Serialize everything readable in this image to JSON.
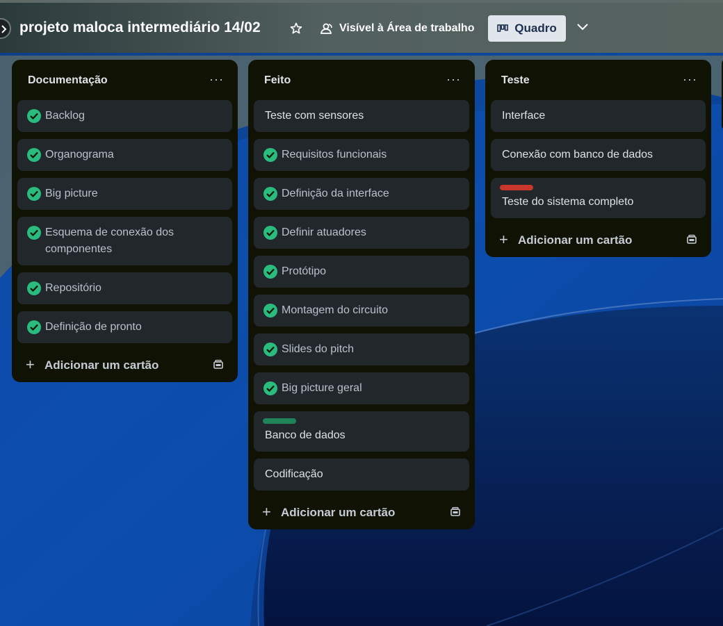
{
  "header": {
    "title": "projeto maloca intermediário 14/02",
    "visibility": "Visível à Área de trabalho",
    "view": "Quadro"
  },
  "icons": {
    "star": "star-icon",
    "visibility": "workspace-visibility-icon",
    "view": "board-view-icon",
    "dropdown": "chevron-down-icon",
    "card_done": "check-circle-icon",
    "add": "plus-icon",
    "template": "card-template-icon"
  },
  "colors": {
    "check": "#2abb7f",
    "label_green": "#1f845a",
    "label_red": "#c9372c",
    "list_bg": "#101204",
    "card_bg": "#22272b"
  },
  "lists": [
    {
      "title": "Documentação",
      "menu": "···",
      "add_label": "Adicionar um cartão",
      "cards": [
        {
          "text": "Backlog",
          "done": true
        },
        {
          "text": "Organograma",
          "done": true
        },
        {
          "text": "Big picture",
          "done": true
        },
        {
          "text": "Esquema de conexão dos componentes",
          "done": true
        },
        {
          "text": "Repositório",
          "done": true
        },
        {
          "text": "Definição de pronto",
          "done": true
        }
      ]
    },
    {
      "title": "Feito",
      "menu": "···",
      "add_label": "Adicionar um cartão",
      "cards": [
        {
          "text": "Teste com sensores",
          "done": false
        },
        {
          "text": "Requisitos funcionais",
          "done": true
        },
        {
          "text": "Definição da interface",
          "done": true
        },
        {
          "text": "Definir atuadores",
          "done": true
        },
        {
          "text": "Protótipo",
          "done": true
        },
        {
          "text": "Montagem do circuito",
          "done": true
        },
        {
          "text": "Slides do pitch",
          "done": true
        },
        {
          "text": "Big picture geral",
          "done": true
        },
        {
          "text": "Banco de dados",
          "done": false,
          "label_color": "#1f845a"
        },
        {
          "text": "Codificação",
          "done": false
        }
      ]
    },
    {
      "title": "Teste",
      "menu": "···",
      "add_label": "Adicionar um cartão",
      "cards": [
        {
          "text": "Interface",
          "done": false
        },
        {
          "text": "Conexão com banco de dados",
          "done": false
        },
        {
          "text": "Teste do sistema completo",
          "done": false,
          "label_color": "#c9372c"
        }
      ]
    }
  ]
}
